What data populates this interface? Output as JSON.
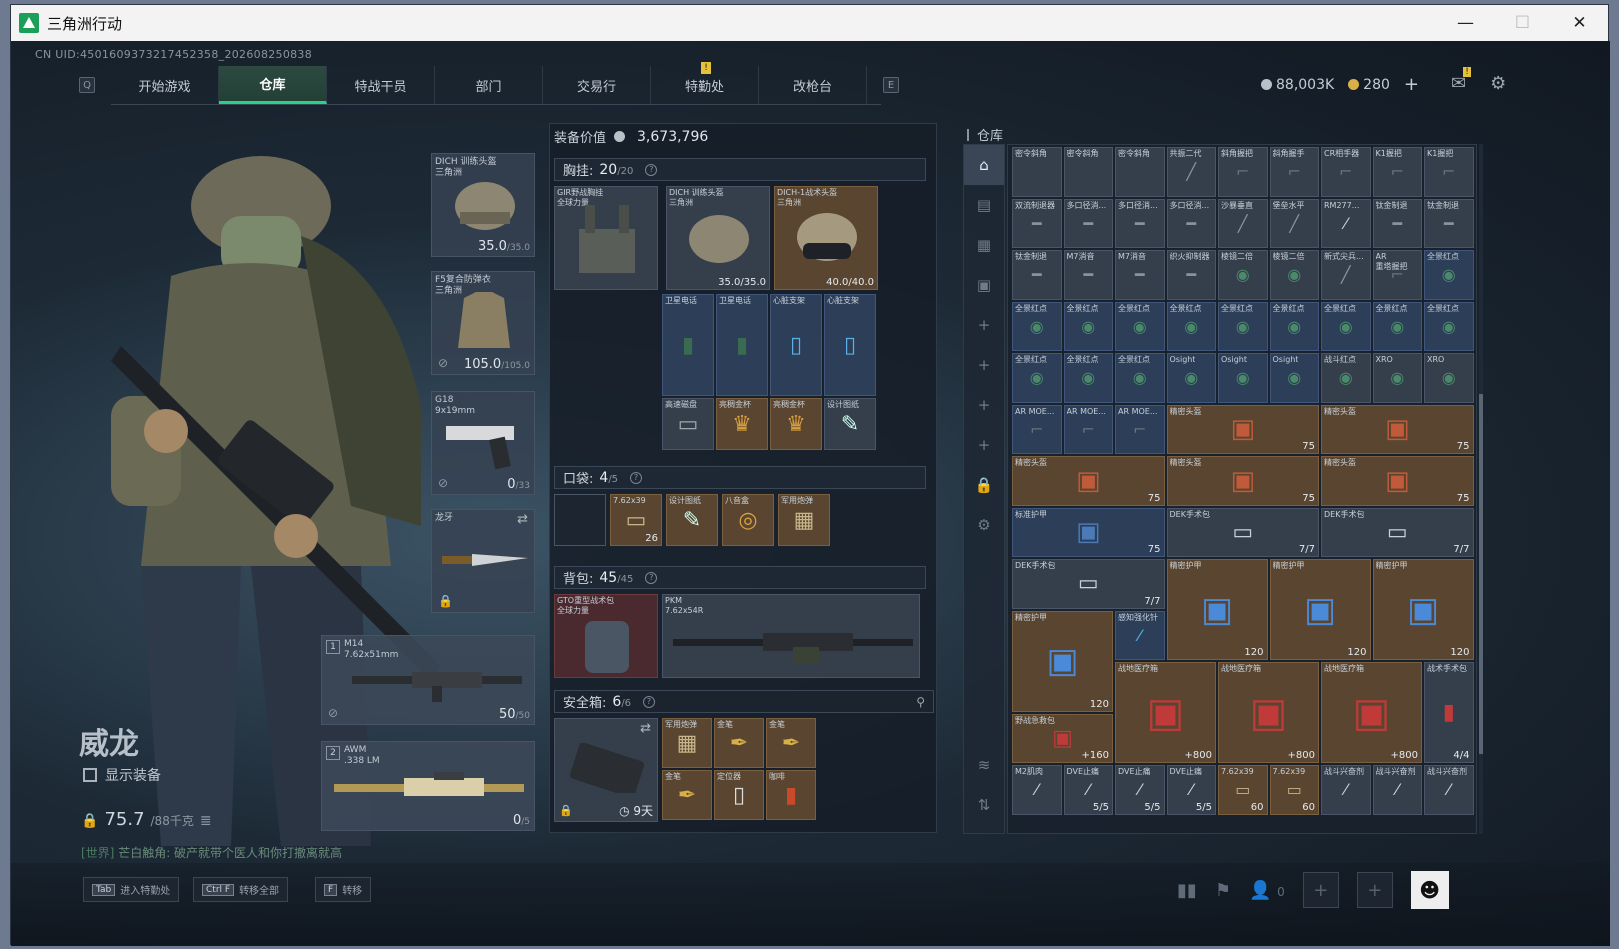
{
  "window": {
    "title": "三角洲行动",
    "minimize": "—",
    "maximize": "☐",
    "close": "✕"
  },
  "uid": "CN UID:4501609373217452358_202608250838",
  "nav": {
    "left_key": "Q",
    "right_key": "E",
    "tabs": [
      "开始游戏",
      "仓库",
      "特战干员",
      "部门",
      "交易行",
      "特勤处",
      "改枪台"
    ],
    "notif": "!"
  },
  "currency": {
    "silver": "88,003K",
    "gold": "280",
    "plus": "+"
  },
  "top_icons": {
    "mail": "✉",
    "mail_notif": "!",
    "settings": "⚙"
  },
  "operator": {
    "name": "威龙",
    "show_gear": "显示装备",
    "weight": "75.7",
    "weight_max": "/88千克"
  },
  "chat": {
    "channel": "[世界]",
    "text": "芒白触角: 破产就带个医人和你打撤离就高"
  },
  "equip": [
    {
      "label": "DICH 训练头盔\n三角洲",
      "value": "35.0",
      "max": "/35.0"
    },
    {
      "label": "F5复合防弹衣\n三角洲",
      "value": "105.0",
      "max": "/105.0"
    },
    {
      "label": "G18\n9x19mm",
      "value": "0",
      "max": "/33"
    },
    {
      "label": "龙牙",
      "value": "",
      "max": ""
    },
    {
      "label": "M14\n7.62x51mm",
      "value": "50",
      "max": "/50",
      "slot": "1"
    },
    {
      "label": "AWM\n.338 LM",
      "value": "0",
      "max": "/5",
      "slot": "2"
    }
  ],
  "gear": {
    "value_label": "装备价值",
    "value": "3,673,796",
    "chest": {
      "label": "胸挂:",
      "count": "20",
      "max": "/20",
      "q": "?"
    },
    "pocket": {
      "label": "口袋:",
      "count": "4",
      "max": "/5",
      "q": "?"
    },
    "backpack": {
      "label": "背包:",
      "count": "45",
      "max": "/45",
      "q": "?"
    },
    "safebox": {
      "label": "安全箱:",
      "count": "6",
      "max": "/6",
      "q": "?",
      "days": "9天"
    },
    "chest_items": [
      {
        "l": "GIR野战胸挂\n全球力量",
        "v": ""
      },
      {
        "l": "DICH 训练头盔\n三角洲",
        "v": "35.0/35.0"
      },
      {
        "l": "DICH-1战术头盔\n三角洲",
        "v": "40.0/40.0"
      }
    ],
    "chest_sub": [
      "卫星电话",
      "卫星电话",
      "心脏支架",
      "心脏支架",
      "高速磁盘",
      "亮稠金杯",
      "亮稠金杯",
      "设计图纸"
    ],
    "pocket_items": [
      {
        "l": "",
        "v": ""
      },
      {
        "l": "7.62x39",
        "v": "26"
      },
      {
        "l": "设计图纸",
        "v": ""
      },
      {
        "l": "八音盒",
        "v": ""
      },
      {
        "l": "军用炮弹",
        "v": ""
      }
    ],
    "backpack_items": [
      {
        "l": "GTO重型战术包\n全球力量",
        "v": ""
      },
      {
        "l": "PKM\n7.62x54R",
        "v": ""
      }
    ],
    "safe_items": [
      "军用炮弹",
      "金笔",
      "金笔",
      "金笔",
      "定位器",
      "咖啡"
    ]
  },
  "warehouse": {
    "title": "仓库",
    "side_icons": [
      "⌂",
      "▤",
      "▦",
      "▣",
      "+",
      "+",
      "+",
      "+",
      "🔒",
      "⚙",
      "≋",
      "⇅"
    ],
    "rows": [
      [
        "密令斜角",
        "密令斜角",
        "密令斜角",
        "共振二代",
        "斜角握把",
        "斜角握手",
        "CR相手器",
        "K1握把",
        "K1握把"
      ],
      [
        "双流制退器",
        "多口径消...",
        "多口径消...",
        "多口径消...",
        "沙暴垂直",
        "堡垒水平",
        "RM277...",
        "钛金制退",
        "钛金制退"
      ],
      [
        "钛金制退",
        "M7消音",
        "M7消音",
        "织火抑制器",
        "棱镜二倍",
        "棱镜二倍",
        "新式尖兵...",
        "AR\n重塔握把",
        "全景红点"
      ],
      [
        "全景红点",
        "全景红点",
        "全景红点",
        "全景红点",
        "全景红点",
        "全景红点",
        "全景红点",
        "全景红点",
        "全景红点"
      ],
      [
        "全景红点",
        "全景红点",
        "全景红点",
        "Osight",
        "Osight",
        "Osight",
        "战斗红点",
        "XRO",
        "XRO"
      ],
      [
        "AR MOE...",
        "AR MOE...",
        "AR MOE...",
        "精密头盔",
        "",
        "",
        "精密头盔",
        "",
        ""
      ],
      [
        "精密头盔",
        "",
        "",
        "精密头盔",
        "",
        "",
        "精密头盔",
        "",
        ""
      ],
      [
        "标准护甲",
        "",
        "",
        "DEK手术包",
        "",
        "",
        "DEK手术包",
        "",
        ""
      ],
      [
        "DEK手术包",
        "",
        "",
        "精密护甲",
        "",
        "精密护甲",
        "",
        "精密护甲",
        ""
      ],
      [
        "精密护甲",
        "",
        "感知强化针",
        "",
        "",
        "",
        "",
        "",
        ""
      ],
      [
        "",
        "",
        "战地医疗箱",
        "",
        "战地医疗箱",
        "",
        "战地医疗箱",
        "",
        "战术手术包"
      ],
      [
        "野战急救包",
        "",
        "",
        "",
        "",
        "",
        "",
        "",
        ""
      ],
      [
        "M2肌肉",
        "DVE止痛",
        "DVE止痛",
        "DVE止痛",
        "7.62x39",
        "7.62x39",
        "战斗兴奋剂",
        "战斗兴奋剂",
        "战斗兴奋剂"
      ]
    ],
    "values": {
      "helmet75": "75",
      "kit77": "7/7",
      "armor120": "120",
      "medkit800": "+800",
      "aid160": "+160",
      "tk44": "4/4",
      "dve55": "5/5",
      "ammo60": "60"
    }
  },
  "hints": [
    {
      "k": "Tab",
      "t": "进入特勤处"
    },
    {
      "k": "Ctrl F",
      "t": "转移全部"
    },
    {
      "k": "F",
      "t": "转移"
    }
  ],
  "bottom_icons": {
    "stats": "▮▮",
    "flag": "⚑",
    "team": "0",
    "plus": "+"
  },
  "colors": {
    "accent": "#2ad18a",
    "gold": "#d8b04a"
  }
}
